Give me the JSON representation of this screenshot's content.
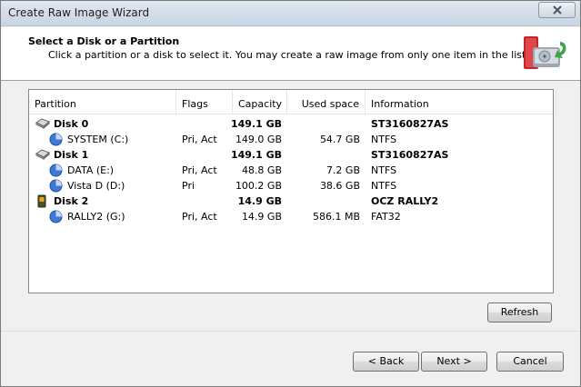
{
  "window": {
    "title": "Create Raw Image Wizard"
  },
  "header": {
    "title": "Select a Disk or a Partition",
    "subtitle": "Click a partition or a disk to select it. You may create a raw image from only one item in the list."
  },
  "table": {
    "columns": [
      "Partition",
      "Flags",
      "Capacity",
      "Used space",
      "Information"
    ],
    "rows": [
      {
        "kind": "disk",
        "icon": "hard-disk-icon",
        "name": "Disk 0",
        "flags": "",
        "capacity": "149.1 GB",
        "used": "",
        "info": "ST3160827AS"
      },
      {
        "kind": "partition",
        "icon": "partition-icon",
        "name": "SYSTEM (C:)",
        "flags": "Pri, Act",
        "capacity": "149.0 GB",
        "used": "54.7 GB",
        "info": "NTFS"
      },
      {
        "kind": "disk",
        "icon": "hard-disk-icon",
        "name": "Disk 1",
        "flags": "",
        "capacity": "149.1 GB",
        "used": "",
        "info": "ST3160827AS"
      },
      {
        "kind": "partition",
        "icon": "partition-icon",
        "name": "DATA (E:)",
        "flags": "Pri, Act",
        "capacity": "48.8 GB",
        "used": "7.2 GB",
        "info": "NTFS"
      },
      {
        "kind": "partition",
        "icon": "partition-icon",
        "name": "Vista D (D:)",
        "flags": "Pri",
        "capacity": "100.2 GB",
        "used": "38.6 GB",
        "info": "NTFS"
      },
      {
        "kind": "disk",
        "icon": "usb-drive-icon",
        "name": "Disk 2",
        "flags": "",
        "capacity": "14.9 GB",
        "used": "",
        "info": "OCZ RALLY2"
      },
      {
        "kind": "partition",
        "icon": "partition-icon",
        "name": "RALLY2 (G:)",
        "flags": "Pri, Act",
        "capacity": "14.9 GB",
        "used": "586.1 MB",
        "info": "FAT32"
      }
    ]
  },
  "buttons": {
    "refresh": "Refresh",
    "back": "< Back",
    "next": "Next >",
    "cancel": "Cancel"
  }
}
